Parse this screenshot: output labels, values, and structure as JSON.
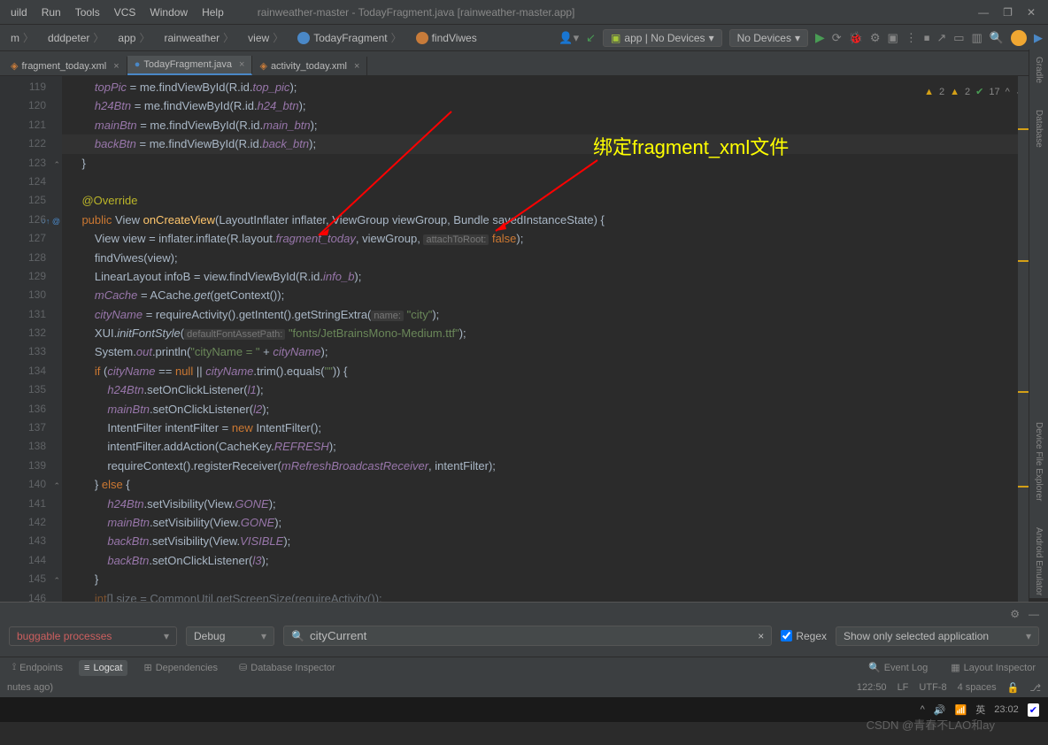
{
  "menu": {
    "items": [
      "uild",
      "Run",
      "Tools",
      "VCS",
      "Window",
      "Help"
    ],
    "title": "rainweather-master - TodayFragment.java [rainweather-master.app]"
  },
  "breadcrumbs": [
    "m",
    "dddpeter",
    "app",
    "rainweather",
    "view",
    "TodayFragment",
    "findViwes"
  ],
  "devices": {
    "app": "app | No Devices",
    "devices": "No Devices"
  },
  "tabs": [
    {
      "label": "fragment_today.xml",
      "active": false
    },
    {
      "label": "TodayFragment.java",
      "active": true
    },
    {
      "label": "activity_today.xml",
      "active": false
    }
  ],
  "inspections": {
    "warn1": "2",
    "warn2": "2",
    "checks": "17"
  },
  "annotation": "绑定fragment_xml文件",
  "line_start": 119,
  "rightbar": [
    "Gradle",
    "Database",
    "Device File Explorer",
    "Android Emulator"
  ],
  "bottom": {
    "debuggable": "buggable processes",
    "config": "Debug",
    "search": "cityCurrent",
    "regex": "Regex",
    "filter": "Show only selected application"
  },
  "bottom_tabs": [
    "Endpoints",
    "Logcat",
    "Dependencies",
    "Database Inspector"
  ],
  "bottom_right": [
    "Event Log",
    "Layout Inspector"
  ],
  "status": {
    "left": "nutes ago)",
    "pos": "122:50",
    "lf": "LF",
    "enc": "UTF-8",
    "indent": "4 spaces"
  },
  "taskbar": {
    "ime": "英",
    "time": "23:02",
    "watermark": "CSDN @青春不LAO和ay"
  }
}
